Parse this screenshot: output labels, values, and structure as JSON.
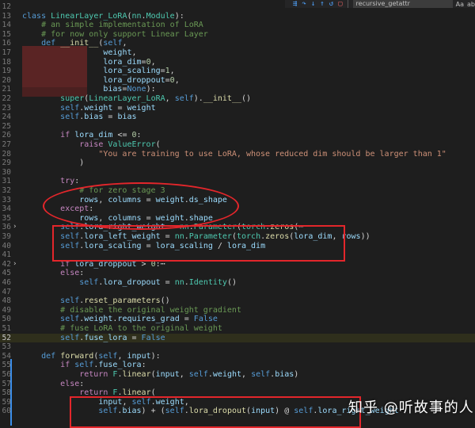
{
  "toolbar": {
    "icons": [
      "step-into-icon",
      "step-over-icon",
      "step-back-icon",
      "continue-icon",
      "restart-icon",
      "stop-icon"
    ],
    "search_value": "recursive_getattr",
    "match_case": "Aa",
    "whole_word": "ab"
  },
  "watermark": "知乎 @听故事的人",
  "lines": [
    {
      "n": "12",
      "html": ""
    },
    {
      "n": "13",
      "html": "<span class='kw'>class</span> <span class='cls'>LinearLayer_LoRA</span>(<span class='cls'>nn</span>.<span class='cls'>Module</span>):"
    },
    {
      "n": "14",
      "html": "    <span class='cmt'># an simple implementation of LoRA</span>"
    },
    {
      "n": "15",
      "html": "    <span class='cmt'># for now only support Linear Layer</span>"
    },
    {
      "n": "16",
      "html": "    <span class='kw'>def</span> <span class='fn'>__init__</span>(<span class='slf'>self</span>,"
    },
    {
      "n": "17",
      "html": "                 <span class='par'>weight</span>,"
    },
    {
      "n": "18",
      "html": "                 <span class='par'>lora_dim</span>=<span class='num'>0</span>,"
    },
    {
      "n": "19",
      "html": "                 <span class='par'>lora_scaling</span>=<span class='num'>1</span>,"
    },
    {
      "n": "20",
      "html": "                 <span class='par'>lora_droppout</span>=<span class='num'>0</span>,"
    },
    {
      "n": "21",
      "html": "                 <span class='par'>bias</span>=<span class='kw'>None</span>):"
    },
    {
      "n": "22",
      "html": "        <span class='cls'>super</span>(<span class='cls'>LinearLayer_LoRA</span>, <span class='slf'>self</span>).<span class='fn'>__init__</span>()"
    },
    {
      "n": "23",
      "html": "        <span class='slf'>self</span>.<span class='par'>weight</span> = <span class='par'>weight</span>"
    },
    {
      "n": "24",
      "html": "        <span class='slf'>self</span>.<span class='par'>bias</span> = <span class='par'>bias</span>"
    },
    {
      "n": "25",
      "html": ""
    },
    {
      "n": "26",
      "html": "        <span class='ctrl'>if</span> <span class='par'>lora_dim</span> &lt;= <span class='num'>0</span>:"
    },
    {
      "n": "27",
      "html": "            <span class='ctrl'>raise</span> <span class='cls'>ValueError</span>("
    },
    {
      "n": "28",
      "html": "                <span class='str'>\"You are training to use LoRA, whose reduced dim should be larger than 1\"</span>"
    },
    {
      "n": "29",
      "html": "            )"
    },
    {
      "n": "30",
      "html": ""
    },
    {
      "n": "31",
      "html": "        <span class='ctrl'>try</span>:"
    },
    {
      "n": "32",
      "html": "            <span class='cmt'># for zero stage 3</span>"
    },
    {
      "n": "33",
      "html": "            <span class='par'>rows</span>, <span class='par'>columns</span> = <span class='par'>weight</span>.<span class='par'>ds_shape</span>"
    },
    {
      "n": "34",
      "html": "        <span class='ctrl'>except</span>:"
    },
    {
      "n": "35",
      "html": "            <span class='par'>rows</span>, <span class='par'>columns</span> = <span class='par'>weight</span>.<span class='par'>shape</span>"
    },
    {
      "n": "36",
      "html": "        <span class='slf'>self</span>.<span class='par'>lora_right_weight</span> = <span class='cls'>nn</span>.<span class='cls'>Parameter</span>(<span class='cls'>torch</span>.<span class='fn'>zeros</span>(<span class='op'>⋯</span>",
      "fold": "›"
    },
    {
      "n": "39",
      "html": "        <span class='slf'>self</span>.<span class='par'>lora_left_weight</span> = <span class='cls'>nn</span>.<span class='cls'>Parameter</span>(<span class='cls'>torch</span>.<span class='fn'>zeros</span>(<span class='par'>lora_dim</span>, <span class='par'>rows</span>))"
    },
    {
      "n": "40",
      "html": "        <span class='slf'>self</span>.<span class='par'>lora_scaling</span> = <span class='par'>lora_scaling</span> / <span class='par'>lora_dim</span>"
    },
    {
      "n": "41",
      "html": ""
    },
    {
      "n": "42",
      "html": "        <span class='ctrl'>if</span> <span class='par'>lora_droppout</span> &gt; <span class='num'>0</span>:<span class='op'>⋯</span>",
      "fold": "›"
    },
    {
      "n": "45",
      "html": "        <span class='ctrl'>else</span>:"
    },
    {
      "n": "46",
      "html": "            <span class='slf'>self</span>.<span class='par'>lora_dropout</span> = <span class='cls'>nn</span>.<span class='cls'>Identity</span>()"
    },
    {
      "n": "47",
      "html": ""
    },
    {
      "n": "48",
      "html": "        <span class='slf'>self</span>.<span class='fn'>reset_parameters</span>()"
    },
    {
      "n": "49",
      "html": "        <span class='cmt'># disable the original weight gradient</span>"
    },
    {
      "n": "50",
      "html": "        <span class='slf'>self</span>.<span class='par'>weight</span>.<span class='par'>requires_grad</span> = <span class='kw'>False</span>"
    },
    {
      "n": "51",
      "html": "        <span class='cmt'># fuse LoRA to the original weight</span>"
    },
    {
      "n": "52",
      "html": "        <span class='slf'>self</span>.<span class='par'>fuse_lora</span> = <span class='kw'>False</span>",
      "hl": true
    },
    {
      "n": "53",
      "html": ""
    },
    {
      "n": "54",
      "html": "    <span class='kw'>def</span> <span class='fn'>forward</span>(<span class='slf'>self</span>, <span class='par'>input</span>):"
    },
    {
      "n": "55",
      "html": "        <span class='ctrl'>if</span> <span class='slf'>self</span>.<span class='par'>fuse_lora</span>:"
    },
    {
      "n": "56",
      "html": "            <span class='ctrl'>return</span> <span class='cls'>F</span>.<span class='fn'>linear</span>(<span class='par'>input</span>, <span class='slf'>self</span>.<span class='par'>weight</span>, <span class='slf'>self</span>.<span class='par'>bias</span>)"
    },
    {
      "n": "57",
      "html": "        <span class='ctrl'>else</span>:"
    },
    {
      "n": "58",
      "html": "            <span class='ctrl'>return</span> <span class='cls'>F</span>.<span class='fn'>linear</span>("
    },
    {
      "n": "59",
      "html": "                <span class='par'>input</span>, <span class='slf'>self</span>.<span class='par'>weight</span>,"
    },
    {
      "n": "60",
      "html": "                <span class='slf'>self</span>.<span class='par'>bias</span>) + (<span class='slf'>self</span>.<span class='fn'>lora_dropout</span>(<span class='par'>input</span>) @ <span class='slf'>self</span>.<span class='par'>lora_right_weight</span>"
    }
  ]
}
